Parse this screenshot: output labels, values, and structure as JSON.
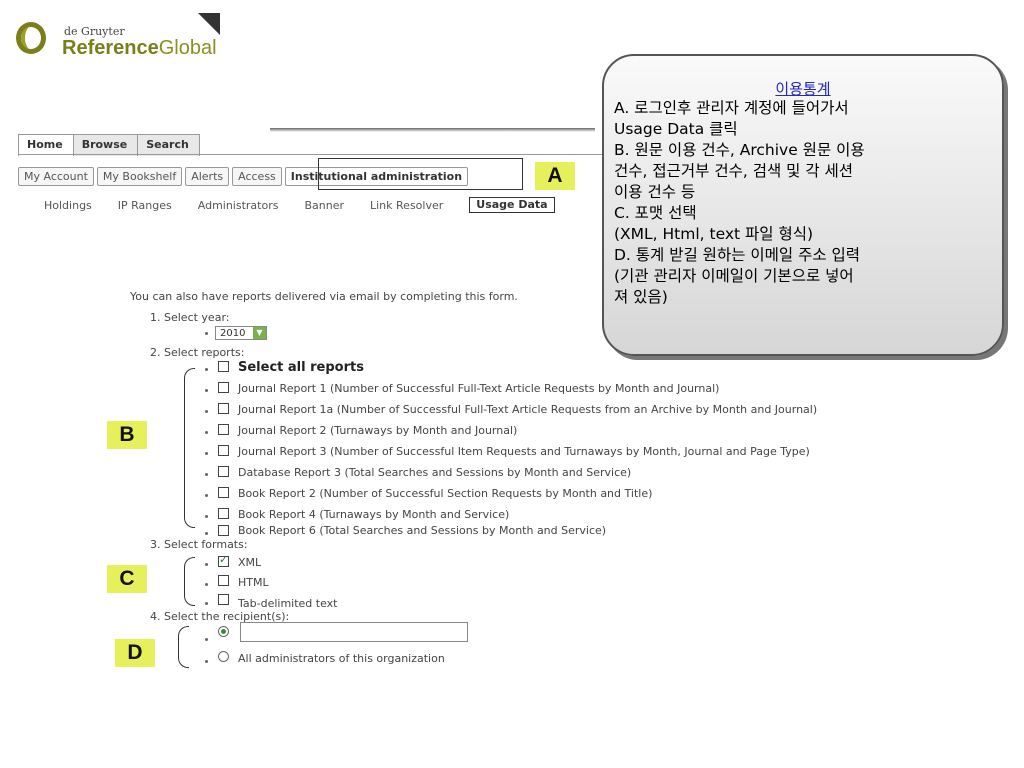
{
  "logo": {
    "line1": "de Gruyter",
    "brand_part1": "Reference",
    "brand_part2": "Global"
  },
  "top_tabs": [
    "Home",
    "Browse",
    "Search"
  ],
  "account_tabs": [
    "My Account",
    "My Bookshelf",
    "Alerts",
    "Access",
    "Institutional administration"
  ],
  "admin_links": [
    "Holdings",
    "IP Ranges",
    "Administrators",
    "Banner",
    "Link Resolver",
    "Usage Data"
  ],
  "markers": {
    "a": "A",
    "b": "B",
    "c": "C",
    "d": "D"
  },
  "callout": {
    "title": "이용통계",
    "lines": [
      "A. 로그인후 관리자 계정에 들어가서",
      "Usage Data 클릭",
      "B. 원문 이용 건수, Archive 원문 이용",
      "건수, 접근거부 건수, 검색 및 각 세션",
      "이용 건수 등",
      "C. 포맷 선택",
      "(XML, Html, text 파일 형식)",
      "D. 통계 받길 원하는 이메일 주소 입력",
      "(기관 관리자 이메일이 기본으로 넣어",
      "져 있음)"
    ]
  },
  "form": {
    "intro": "You can also have reports delivered via email by completing this form.",
    "step1": "1.  Select year:",
    "year": "2010",
    "step2": "2.  Select reports:",
    "select_all": "Select all reports",
    "reports": [
      "Journal Report 1 (Number of Successful Full-Text Article Requests by Month and Journal)",
      "Journal Report 1a (Number of Successful Full-Text Article Requests from an Archive by Month and Journal)",
      "Journal Report 2 (Turnaways by Month and Journal)",
      "Journal Report 3 (Number of Successful Item Requests and Turnaways by Month, Journal and Page Type)",
      "Database Report 3 (Total Searches and Sessions by Month and Service)",
      "Book Report 2 (Number of Successful Section Requests by Month and Title)",
      "Book Report 4 (Turnaways by Month and Service)",
      "Book Report 6 (Total Searches and Sessions by Month and Service)"
    ],
    "step3": "3.  Select formats:",
    "formats": [
      "XML",
      "HTML",
      "Tab-delimited text"
    ],
    "formats_checked": [
      true,
      false,
      false
    ],
    "step4": "4.  Select the recipient(s):",
    "recipient_email": "",
    "recipient_all": "All administrators of this organization"
  }
}
